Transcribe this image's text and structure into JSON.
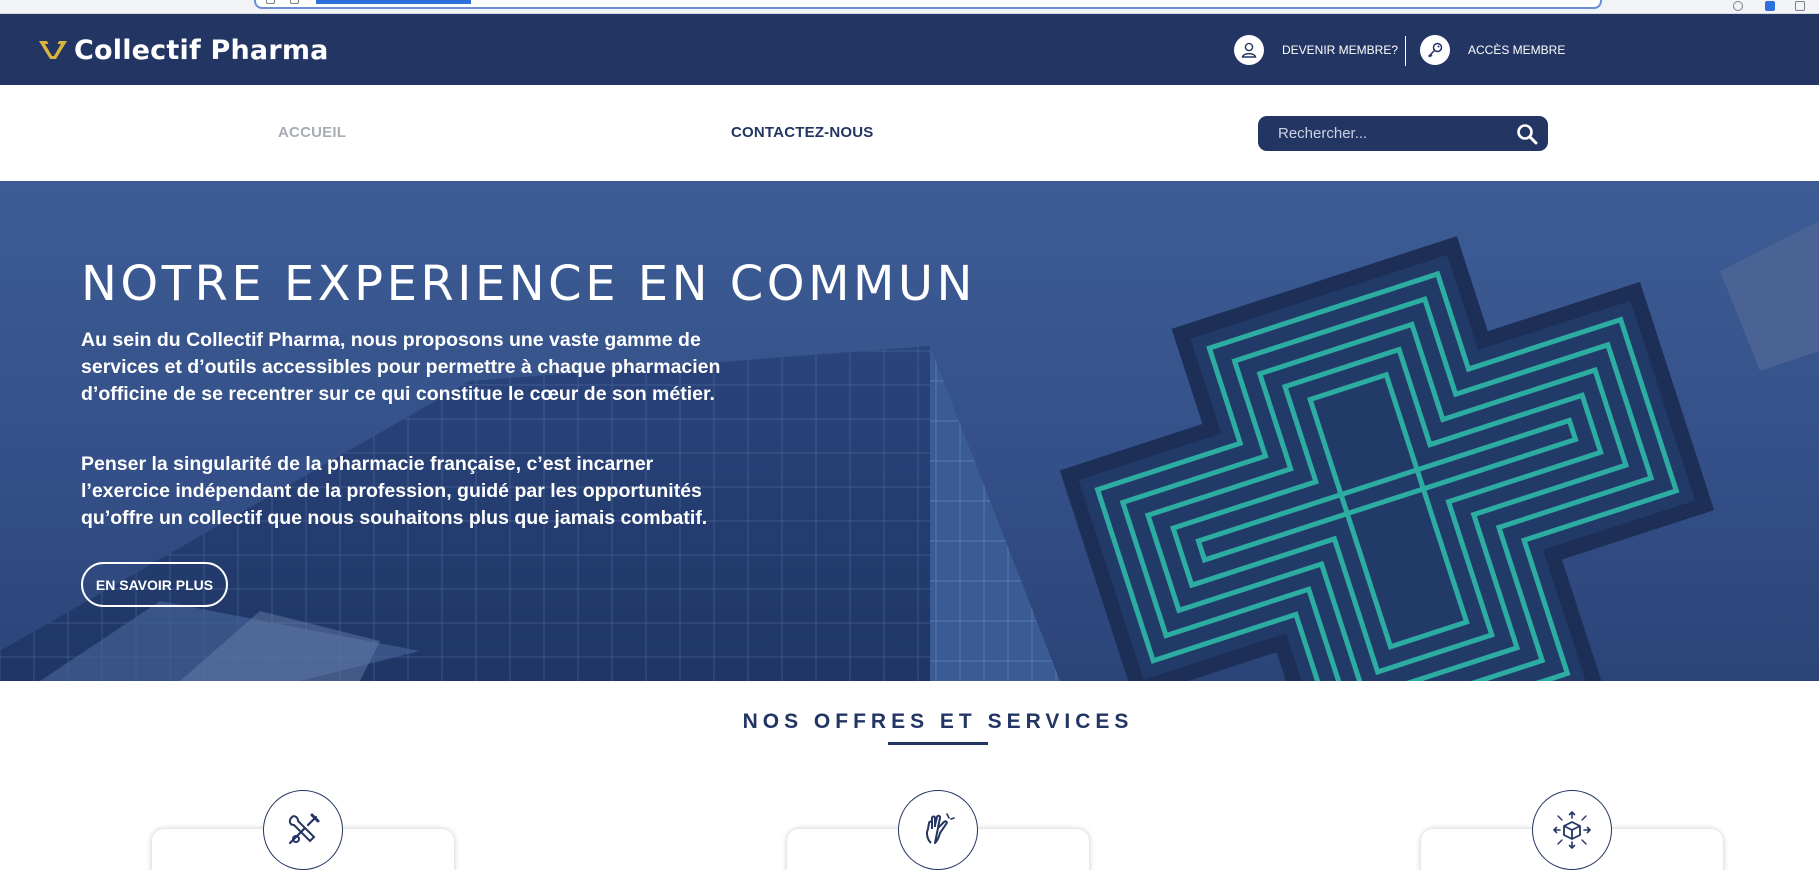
{
  "brand": {
    "name": "Collectif Pharma",
    "colors": {
      "navy": "#223563",
      "gold": "#d9b53d",
      "teal": "#2fb9a8"
    }
  },
  "header": {
    "become_member": {
      "label": "DEVENIR MEMBRE?",
      "icon": "user-icon"
    },
    "member_access": {
      "label": "ACCÈS MEMBRE",
      "icon": "key-icon"
    }
  },
  "nav": {
    "items": [
      {
        "label": "ACCUEIL",
        "active": true
      },
      {
        "label": "CONTACTEZ-NOUS",
        "active": false
      }
    ],
    "search": {
      "placeholder": "Rechercher...",
      "icon": "search-icon"
    }
  },
  "hero": {
    "title": "NOTRE EXPERIENCE EN COMMUN",
    "paragraph1": "Au sein du Collectif Pharma, nous proposons une vaste gamme de services et d’outils accessibles pour permettre à chaque pharmacien d’officine de se recentrer sur ce qui constitue le cœur de son métier.",
    "paragraph2": "Penser la singularité de la pharmacie française, c’est incarner l’exercice indépendant de la profession, guidé par les opportunités qu’offre un collectif que nous souhaitons plus que jamais combatif.",
    "button": "EN SAVOIR PLUS"
  },
  "offers": {
    "title": "NOS OFFRES ET SERVICES",
    "cards": [
      {
        "icon": "tools-icon"
      },
      {
        "icon": "hand-gesture-icon"
      },
      {
        "icon": "box-expand-icon"
      }
    ]
  }
}
